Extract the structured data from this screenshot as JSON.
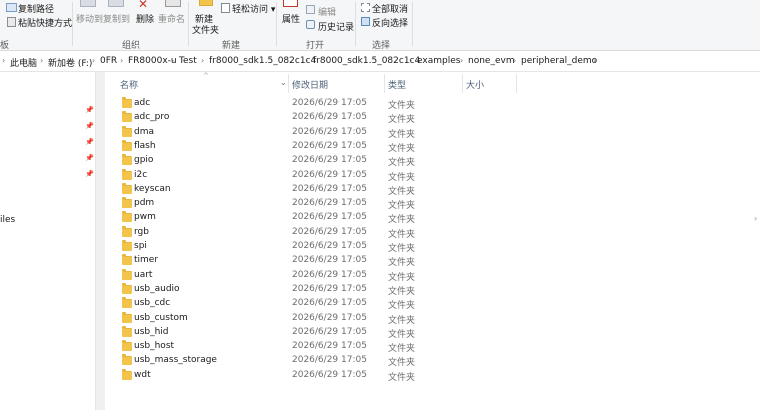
{
  "ribbon": {
    "clipboard": {
      "copy_path": "复制路径",
      "paste_shortcut": "粘贴快捷方式",
      "label_partial": "板"
    },
    "organize": {
      "move_to": "移动到",
      "copy_to": "复制到",
      "delete": "删除",
      "rename": "重命名",
      "label": "组织"
    },
    "new": {
      "new_folder_line1": "新建",
      "new_folder_line2": "文件夹",
      "easy_access": "轻松访问 ▾",
      "label": "新建"
    },
    "open": {
      "properties": "属性",
      "edit": "编辑",
      "history": "历史记录",
      "label": "打开"
    },
    "select": {
      "select_none": "全部取消",
      "invert_selection": "反向选择",
      "label": "选择"
    }
  },
  "breadcrumb": [
    "此电脑",
    "新加卷 (F:)",
    "0FR",
    "FR8000x-u",
    "Test",
    "fr8000_sdk1.5_082c1c4",
    "fr8000_sdk1.5_082c1c4",
    "examples",
    "none_evm",
    "peripheral_demo"
  ],
  "nav": {
    "partial_item": "iles"
  },
  "columns": {
    "name": "名称",
    "modified": "修改日期",
    "type": "类型",
    "size": "大小"
  },
  "files": [
    {
      "name": "adc",
      "modified": "2026/6/29 17:05",
      "type": "文件夹"
    },
    {
      "name": "adc_pro",
      "modified": "2026/6/29 17:05",
      "type": "文件夹"
    },
    {
      "name": "dma",
      "modified": "2026/6/29 17:05",
      "type": "文件夹"
    },
    {
      "name": "flash",
      "modified": "2026/6/29 17:05",
      "type": "文件夹"
    },
    {
      "name": "gpio",
      "modified": "2026/6/29 17:05",
      "type": "文件夹"
    },
    {
      "name": "i2c",
      "modified": "2026/6/29 17:05",
      "type": "文件夹"
    },
    {
      "name": "keyscan",
      "modified": "2026/6/29 17:05",
      "type": "文件夹"
    },
    {
      "name": "pdm",
      "modified": "2026/6/29 17:05",
      "type": "文件夹"
    },
    {
      "name": "pwm",
      "modified": "2026/6/29 17:05",
      "type": "文件夹"
    },
    {
      "name": "rgb",
      "modified": "2026/6/29 17:05",
      "type": "文件夹"
    },
    {
      "name": "spi",
      "modified": "2026/6/29 17:05",
      "type": "文件夹"
    },
    {
      "name": "timer",
      "modified": "2026/6/29 17:05",
      "type": "文件夹"
    },
    {
      "name": "uart",
      "modified": "2026/6/29 17:05",
      "type": "文件夹"
    },
    {
      "name": "usb_audio",
      "modified": "2026/6/29 17:05",
      "type": "文件夹"
    },
    {
      "name": "usb_cdc",
      "modified": "2026/6/29 17:05",
      "type": "文件夹"
    },
    {
      "name": "usb_custom",
      "modified": "2026/6/29 17:05",
      "type": "文件夹"
    },
    {
      "name": "usb_hid",
      "modified": "2026/6/29 17:05",
      "type": "文件夹"
    },
    {
      "name": "usb_host",
      "modified": "2026/6/29 17:05",
      "type": "文件夹"
    },
    {
      "name": "usb_mass_storage",
      "modified": "2026/6/29 17:05",
      "type": "文件夹"
    },
    {
      "name": "wdt",
      "modified": "2026/6/29 17:05",
      "type": "文件夹"
    }
  ],
  "colors": {
    "folder": "#f3c44c",
    "header_text": "#4c607a",
    "ribbon_bg": "#f5f6f7"
  }
}
